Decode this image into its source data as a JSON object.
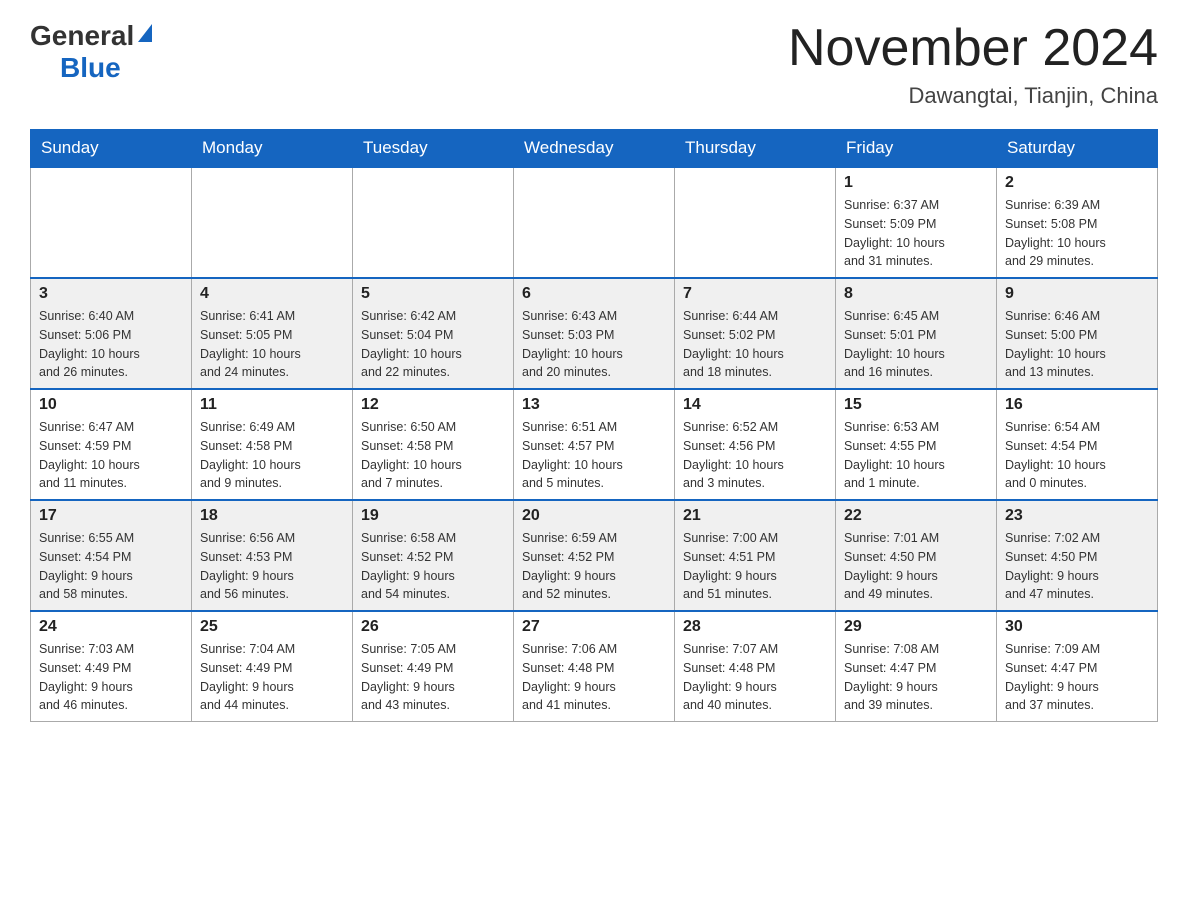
{
  "logo": {
    "general": "General",
    "blue": "Blue"
  },
  "title": "November 2024",
  "location": "Dawangtai, Tianjin, China",
  "days_of_week": [
    "Sunday",
    "Monday",
    "Tuesday",
    "Wednesday",
    "Thursday",
    "Friday",
    "Saturday"
  ],
  "weeks": [
    [
      {
        "day": "",
        "info": ""
      },
      {
        "day": "",
        "info": ""
      },
      {
        "day": "",
        "info": ""
      },
      {
        "day": "",
        "info": ""
      },
      {
        "day": "",
        "info": ""
      },
      {
        "day": "1",
        "info": "Sunrise: 6:37 AM\nSunset: 5:09 PM\nDaylight: 10 hours\nand 31 minutes."
      },
      {
        "day": "2",
        "info": "Sunrise: 6:39 AM\nSunset: 5:08 PM\nDaylight: 10 hours\nand 29 minutes."
      }
    ],
    [
      {
        "day": "3",
        "info": "Sunrise: 6:40 AM\nSunset: 5:06 PM\nDaylight: 10 hours\nand 26 minutes."
      },
      {
        "day": "4",
        "info": "Sunrise: 6:41 AM\nSunset: 5:05 PM\nDaylight: 10 hours\nand 24 minutes."
      },
      {
        "day": "5",
        "info": "Sunrise: 6:42 AM\nSunset: 5:04 PM\nDaylight: 10 hours\nand 22 minutes."
      },
      {
        "day": "6",
        "info": "Sunrise: 6:43 AM\nSunset: 5:03 PM\nDaylight: 10 hours\nand 20 minutes."
      },
      {
        "day": "7",
        "info": "Sunrise: 6:44 AM\nSunset: 5:02 PM\nDaylight: 10 hours\nand 18 minutes."
      },
      {
        "day": "8",
        "info": "Sunrise: 6:45 AM\nSunset: 5:01 PM\nDaylight: 10 hours\nand 16 minutes."
      },
      {
        "day": "9",
        "info": "Sunrise: 6:46 AM\nSunset: 5:00 PM\nDaylight: 10 hours\nand 13 minutes."
      }
    ],
    [
      {
        "day": "10",
        "info": "Sunrise: 6:47 AM\nSunset: 4:59 PM\nDaylight: 10 hours\nand 11 minutes."
      },
      {
        "day": "11",
        "info": "Sunrise: 6:49 AM\nSunset: 4:58 PM\nDaylight: 10 hours\nand 9 minutes."
      },
      {
        "day": "12",
        "info": "Sunrise: 6:50 AM\nSunset: 4:58 PM\nDaylight: 10 hours\nand 7 minutes."
      },
      {
        "day": "13",
        "info": "Sunrise: 6:51 AM\nSunset: 4:57 PM\nDaylight: 10 hours\nand 5 minutes."
      },
      {
        "day": "14",
        "info": "Sunrise: 6:52 AM\nSunset: 4:56 PM\nDaylight: 10 hours\nand 3 minutes."
      },
      {
        "day": "15",
        "info": "Sunrise: 6:53 AM\nSunset: 4:55 PM\nDaylight: 10 hours\nand 1 minute."
      },
      {
        "day": "16",
        "info": "Sunrise: 6:54 AM\nSunset: 4:54 PM\nDaylight: 10 hours\nand 0 minutes."
      }
    ],
    [
      {
        "day": "17",
        "info": "Sunrise: 6:55 AM\nSunset: 4:54 PM\nDaylight: 9 hours\nand 58 minutes."
      },
      {
        "day": "18",
        "info": "Sunrise: 6:56 AM\nSunset: 4:53 PM\nDaylight: 9 hours\nand 56 minutes."
      },
      {
        "day": "19",
        "info": "Sunrise: 6:58 AM\nSunset: 4:52 PM\nDaylight: 9 hours\nand 54 minutes."
      },
      {
        "day": "20",
        "info": "Sunrise: 6:59 AM\nSunset: 4:52 PM\nDaylight: 9 hours\nand 52 minutes."
      },
      {
        "day": "21",
        "info": "Sunrise: 7:00 AM\nSunset: 4:51 PM\nDaylight: 9 hours\nand 51 minutes."
      },
      {
        "day": "22",
        "info": "Sunrise: 7:01 AM\nSunset: 4:50 PM\nDaylight: 9 hours\nand 49 minutes."
      },
      {
        "day": "23",
        "info": "Sunrise: 7:02 AM\nSunset: 4:50 PM\nDaylight: 9 hours\nand 47 minutes."
      }
    ],
    [
      {
        "day": "24",
        "info": "Sunrise: 7:03 AM\nSunset: 4:49 PM\nDaylight: 9 hours\nand 46 minutes."
      },
      {
        "day": "25",
        "info": "Sunrise: 7:04 AM\nSunset: 4:49 PM\nDaylight: 9 hours\nand 44 minutes."
      },
      {
        "day": "26",
        "info": "Sunrise: 7:05 AM\nSunset: 4:49 PM\nDaylight: 9 hours\nand 43 minutes."
      },
      {
        "day": "27",
        "info": "Sunrise: 7:06 AM\nSunset: 4:48 PM\nDaylight: 9 hours\nand 41 minutes."
      },
      {
        "day": "28",
        "info": "Sunrise: 7:07 AM\nSunset: 4:48 PM\nDaylight: 9 hours\nand 40 minutes."
      },
      {
        "day": "29",
        "info": "Sunrise: 7:08 AM\nSunset: 4:47 PM\nDaylight: 9 hours\nand 39 minutes."
      },
      {
        "day": "30",
        "info": "Sunrise: 7:09 AM\nSunset: 4:47 PM\nDaylight: 9 hours\nand 37 minutes."
      }
    ]
  ]
}
